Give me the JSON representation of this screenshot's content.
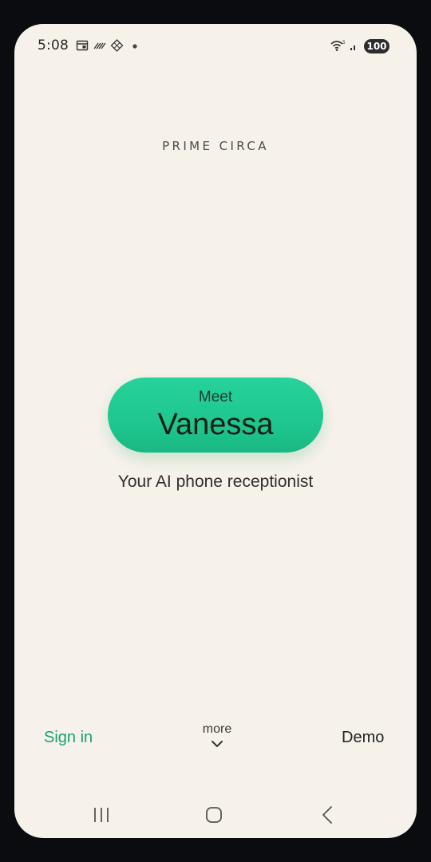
{
  "status_bar": {
    "time": "5:08",
    "battery": "100",
    "icons": [
      "calendar-icon",
      "hatched-icon",
      "diamond-grid-icon",
      "notification-dot-icon",
      "wifi-icon",
      "signal-icon"
    ]
  },
  "brand": {
    "name": "PRIME CIRCA"
  },
  "hero": {
    "meet_label": "Meet",
    "name": "Vanessa",
    "tagline": "Your AI phone receptionist",
    "accent_color": "#1fc68f"
  },
  "bottom_actions": {
    "sign_in": "Sign in",
    "more": "more",
    "demo": "Demo",
    "sign_in_color": "#16a36d"
  },
  "nav_bar": {
    "icons": [
      "recent-apps-icon",
      "home-icon",
      "back-icon"
    ]
  }
}
